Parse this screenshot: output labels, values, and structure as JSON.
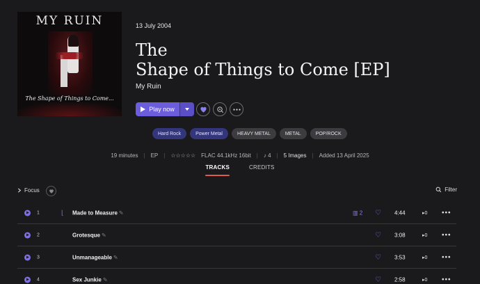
{
  "album": {
    "cover": {
      "band_text": "MY RUIN",
      "title_text": "The Shape of Things to Come..."
    },
    "date": "13 July 2004",
    "title_line1": "The",
    "title_line2": "Shape of Things to Come [EP]",
    "artist": "My Ruin"
  },
  "actions": {
    "play_label": "Play now",
    "heart_icon": "heart-icon",
    "radio_icon": "radio-icon",
    "more_icon": "more-icon"
  },
  "tags": [
    {
      "label": "Hard Rock",
      "kind": "genre"
    },
    {
      "label": "Power Metal",
      "kind": "genre"
    },
    {
      "label": "HEAVY METAL",
      "kind": "style"
    },
    {
      "label": "METAL",
      "kind": "style"
    },
    {
      "label": "POP/ROCK",
      "kind": "style"
    }
  ],
  "meta": {
    "duration": "19 minutes",
    "type": "EP",
    "rating": "☆☆☆☆☆",
    "format": "FLAC 44.1kHz 16bit",
    "bpm_icon_text": "♪ 4",
    "images": "5 Images",
    "added": "Added 13 April 2025"
  },
  "tabs": {
    "tracks": "TRACKS",
    "credits": "CREDITS"
  },
  "toolbar": {
    "focus_label": "Focus",
    "filter_label": "Filter"
  },
  "tracks": [
    {
      "num": "1",
      "title": "Made to Measure",
      "versions": "2",
      "duration": "4:44",
      "plays": "0"
    },
    {
      "num": "2",
      "title": "Grotesque",
      "versions": "",
      "duration": "3:08",
      "plays": "0"
    },
    {
      "num": "3",
      "title": "Unmanageable",
      "versions": "",
      "duration": "3:53",
      "plays": "0"
    },
    {
      "num": "4",
      "title": "Sex Junkie",
      "versions": "",
      "duration": "2:58",
      "plays": "0"
    }
  ],
  "colors": {
    "background": "#1a1a1d",
    "accent": "#6b5ddb",
    "genre_tag": "#33367a",
    "active_tab_underline": "#e05a4c"
  }
}
